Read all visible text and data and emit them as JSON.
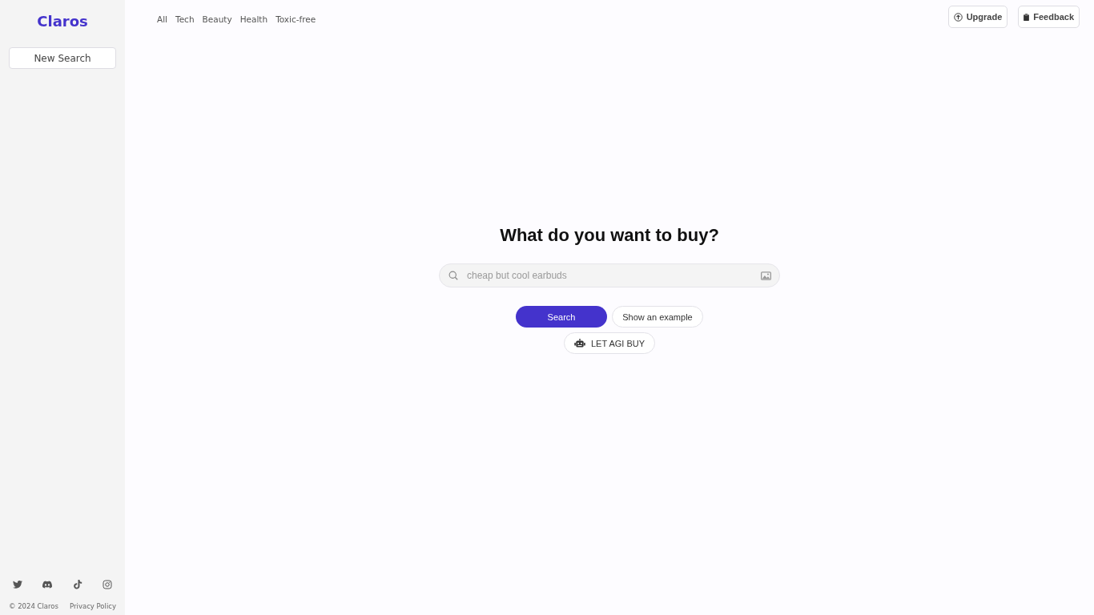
{
  "sidebar": {
    "logo": "Claros",
    "new_search_button": "New Search",
    "footer": {
      "copyright": "© 2024 Claros",
      "privacy_link": "Privacy Policy"
    }
  },
  "nav": {
    "categories": [
      "All",
      "Tech",
      "Beauty",
      "Health",
      "Toxic-free"
    ]
  },
  "header_buttons": [
    {
      "label": "Upgrade",
      "kind": "upgrade"
    },
    {
      "label": "Feedback",
      "kind": "feedback"
    }
  ],
  "hero": {
    "title": "What do you want to buy?",
    "search": {
      "placeholder": "cheap but cool earbuds"
    },
    "buttons": [
      {
        "label": "Search",
        "kind": "primary"
      },
      {
        "label": "Show an example",
        "kind": "secondary"
      }
    ],
    "agent_button": "LET AGI BUY"
  }
}
